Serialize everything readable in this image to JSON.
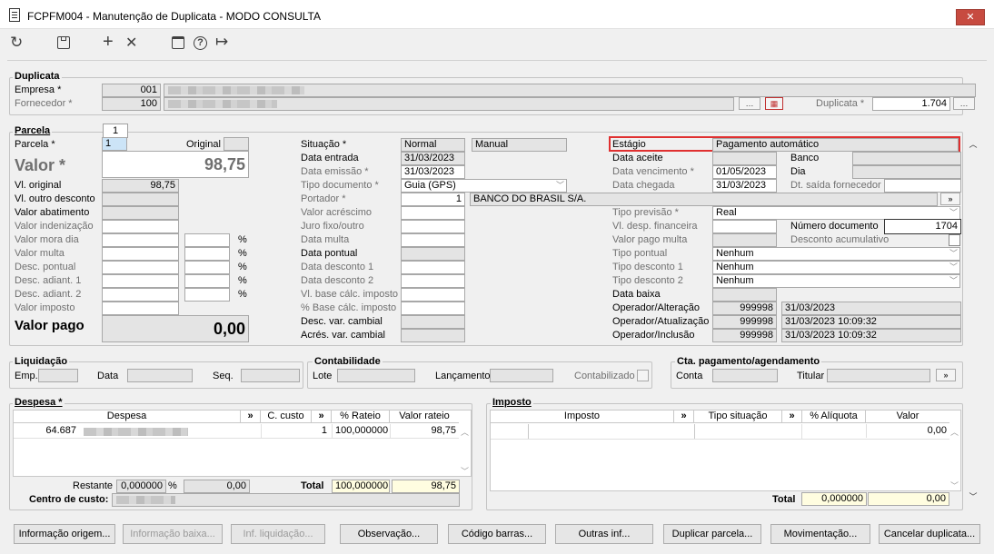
{
  "window": {
    "title": "FCPFM004 - Manutenção de Duplicata - MODO CONSULTA",
    "close_label": "✕"
  },
  "toolbar": {
    "refresh": "↻",
    "save": "💾",
    "add": "+",
    "remove": "✕",
    "calendar": "📅",
    "help": "?",
    "exit": "↦"
  },
  "duplicata": {
    "title": "Duplicata",
    "empresa_label": "Empresa *",
    "empresa_code": "001",
    "fornecedor_label": "Fornecedor *",
    "fornecedor_code": "100",
    "duplicata_label": "Duplicata *",
    "duplicata_value": "1.704"
  },
  "parcela": {
    "title": "Parcela",
    "tab": "1",
    "parcela_label": "Parcela *",
    "parcela_value": "1",
    "original_label": "Original",
    "valor_label": "Valor *",
    "valor_value": "98,75",
    "valor_original_label": "Vl. original",
    "valor_original_value": "98,75",
    "outro_desconto_label": "Vl. outro desconto",
    "abatimento_label": "Valor abatimento",
    "indenizacao_label": "Valor indenização",
    "mora_label": "Valor mora dia",
    "multa_label": "Valor multa",
    "desc_pontual_label": "Desc. pontual",
    "desc_adiant1_label": "Desc. adiant. 1",
    "desc_adiant2_label": "Desc. adiant. 2",
    "imposto_label": "Valor imposto",
    "pct": "%",
    "valor_pago_label": "Valor pago",
    "valor_pago_value": "0,00"
  },
  "mid": {
    "situacao_label": "Situação *",
    "situacao_value": "Normal",
    "situacao_extra": "Manual",
    "data_entrada_label": "Data entrada",
    "data_entrada_value": "31/03/2023",
    "data_emissao_label": "Data emissão *",
    "data_emissao_value": "31/03/2023",
    "tipo_doc_label": "Tipo documento *",
    "tipo_doc_value": "Guia (GPS)",
    "portador_label": "Portador *",
    "portador_code": "1",
    "portador_name": "BANCO DO BRASIL S/A.",
    "acrescimo_label": "Valor acréscimo",
    "juro_label": "Juro fixo/outro",
    "data_multa_label": "Data multa",
    "data_pontual_label": "Data pontual",
    "data_desc1_label": "Data desconto 1",
    "data_desc2_label": "Data desconto 2",
    "base_calc_label": "Vl. base cálc. imposto",
    "pct_base_label": "% Base cálc. imposto",
    "desc_var_label": "Desc. var. cambial",
    "acres_var_label": "Acrés. var. cambial"
  },
  "right": {
    "estagio_label": "Estágio",
    "estagio_value": "Pagamento automático",
    "data_aceite_label": "Data aceite",
    "banco_label": "Banco",
    "venc_label": "Data vencimento *",
    "venc_value": "01/05/2023",
    "dia_label": "Dia",
    "chegada_label": "Data chegada",
    "chegada_value": "31/03/2023",
    "saida_label": "Dt. saída fornecedor",
    "previsao_label": "Tipo previsão *",
    "previsao_value": "Real",
    "desp_fin_label": "Vl. desp. financeira",
    "num_doc_label": "Número documento",
    "num_doc_value": "1704",
    "pago_multa_label": "Valor pago multa",
    "desc_acum_label": "Desconto acumulativo",
    "tipo_pontual_label": "Tipo pontual",
    "tipo_pontual_value": "Nenhum",
    "tipo_desc1_label": "Tipo desconto 1",
    "tipo_desc1_value": "Nenhum",
    "tipo_desc2_label": "Tipo desconto 2",
    "tipo_desc2_value": "Nenhum",
    "data_baixa_label": "Data baixa",
    "op_alt_label": "Operador/Alteração",
    "op_alt_code": "999998",
    "op_alt_date": "31/03/2023",
    "op_atu_label": "Operador/Atualização",
    "op_atu_code": "999998",
    "op_atu_date": "31/03/2023 10:09:32",
    "op_inc_label": "Operador/Inclusão",
    "op_inc_code": "999998",
    "op_inc_date": "31/03/2023 10:09:32"
  },
  "liquidacao": {
    "title": "Liquidação",
    "emp_label": "Emp.",
    "data_label": "Data",
    "seq_label": "Seq."
  },
  "contabilidade": {
    "title": "Contabilidade",
    "lote_label": "Lote",
    "lancamento_label": "Lançamento",
    "contabilizado_label": "Contabilizado"
  },
  "cta": {
    "title": "Cta. pagamento/agendamento",
    "conta_label": "Conta",
    "titular_label": "Titular"
  },
  "despesa": {
    "title": "Despesa *",
    "headers": [
      "Despesa",
      "»",
      "C. custo",
      "»",
      "% Rateio",
      "Valor rateio"
    ],
    "row": {
      "code": "64.687",
      "ccusto": "1",
      "rateio": "100,000000",
      "valor": "98,75"
    },
    "restante_label": "Restante",
    "restante_pct": "0,000000",
    "pct": "%",
    "restante_val": "0,00",
    "total_label": "Total",
    "total_pct": "100,000000",
    "total_val": "98,75",
    "centro_label": "Centro de custo:"
  },
  "imposto": {
    "title": "Imposto",
    "headers": [
      "Imposto",
      "»",
      "Tipo situação",
      "»",
      "% Alíquota",
      "Valor"
    ],
    "row_valor": "0,00",
    "total_label": "Total",
    "total_pct": "0,000000",
    "total_val": "0,00"
  },
  "buttons": [
    "Informação origem...",
    "Informação baixa...",
    "Inf. liquidação...",
    "Observação...",
    "Código barras...",
    "Outras inf...",
    "Duplicar parcela...",
    "Movimentação...",
    "Cancelar duplicata..."
  ],
  "colors": {
    "estagio_border": "#e03030",
    "highlight": "#fffde0",
    "selected": "#cce4f7"
  }
}
